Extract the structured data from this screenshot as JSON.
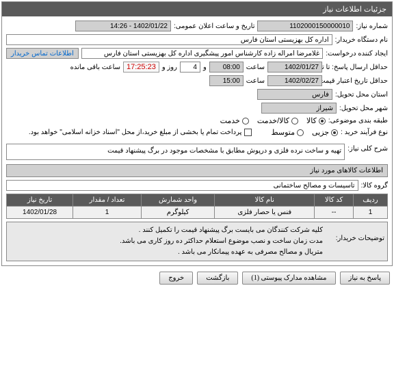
{
  "header": {
    "title": "جزئیات اطلاعات نیاز"
  },
  "fields": {
    "need_number_label": "شماره نیاز:",
    "need_number": "1102000150000010",
    "announce_label": "تاریخ و ساعت اعلان عمومی:",
    "announce_value": "1402/01/22 - 14:26",
    "buyer_label": "نام دستگاه خریدار:",
    "buyer_value": "اداره کل بهزیستی استان فارس",
    "requester_label": "ایجاد کننده درخواست:",
    "requester_value": "غلامرضا امراله زاده کارشناس امور پیشگیری اداره کل بهزیستی استان فارس",
    "contact_link": "اطلاعات تماس خریدار",
    "deadline_label": "حداقل ارسال پاسخ: تا تاریخ:",
    "deadline_date": "1402/01/27",
    "time_label": "ساعت",
    "deadline_time": "08:00",
    "and_label": "و",
    "days_value": "4",
    "day_label": "روز و",
    "countdown": "17:25:23",
    "remaining_label": "ساعت باقی مانده",
    "validity_label": "حداقل تاریخ اعتبار قیمت: تا تاریخ:",
    "validity_date": "1402/02/27",
    "validity_time": "15:00",
    "location_label": "استان محل تحویل:",
    "location_value": "فارس",
    "city_label": "شهر محل تحویل:",
    "city_value": "شیراز",
    "category_label": "طبقه بندی موضوعی:",
    "goods": "کالا",
    "service_goods": "کالا/خدمت",
    "service": "خدمت",
    "buy_type_label": "نوع فرآیند خرید :",
    "partial": "جزیی",
    "medium": "متوسط",
    "payment_note": "پرداخت تمام یا بخشی از مبلغ خرید،از محل \"اسناد خزانه اسلامی\" خواهد بود.",
    "summary_label": "شرح کلی نیاز:",
    "summary_text": "تهیه و ساخت نرده فلزی و درپوش مطابق با مشخصات موجود در برگ پیشنهاد قیمت",
    "items_section": "اطلاعات کالاهای مورد نیاز",
    "group_label": "گروه کالا:",
    "group_value": "تاسیسات و مصالح ساختمانی",
    "notes_label": "توضیحات خریدار:",
    "notes_line1": "کلیه شرکت کنندگان می بایست برگ پیشنهاد قیمت را تکمیل کنند .",
    "notes_line2": "مدت زمان ساخت و نصب  موضوع استعلام حداکثر ده روز کاری می باشد.",
    "notes_line3": "متریال و مصالح مصرفی به عهده پیمانکار می باشد ."
  },
  "table": {
    "headers": {
      "row": "ردیف",
      "code": "کد کالا",
      "name": "نام کالا",
      "unit": "واحد شمارش",
      "qty": "تعداد / مقدار",
      "date": "تاریخ نیاز"
    },
    "rows": [
      {
        "row": "1",
        "code": "--",
        "name": "فنس یا حصار فلزی",
        "unit": "کیلوگرم",
        "qty": "1",
        "date": "1402/01/28"
      }
    ]
  },
  "buttons": {
    "respond": "پاسخ به نیاز",
    "attachments": "مشاهده مدارک پیوستی (1)",
    "back": "بازگشت",
    "exit": "خروج"
  }
}
